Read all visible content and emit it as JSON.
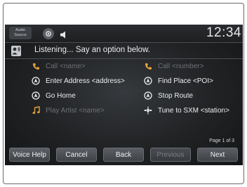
{
  "status_bar": {
    "audio_source_label": "Audio Source",
    "phone_icon": "phone-status-icon",
    "speaker_icon": "speaker-icon",
    "clock": "12:34"
  },
  "prompt": {
    "icon": "voice-command-icon",
    "text": "Listening... Say an option below."
  },
  "options": {
    "call_name": {
      "label": "Call <name>",
      "enabled": false,
      "icon": "phone-icon"
    },
    "call_number": {
      "label": "Call <number>",
      "enabled": false,
      "icon": "phone-icon"
    },
    "enter_address": {
      "label": "Enter Address <address>",
      "enabled": true,
      "icon": "navigation-icon"
    },
    "find_place": {
      "label": "Find Place <POI>",
      "enabled": true,
      "icon": "navigation-icon"
    },
    "go_home": {
      "label": "Go Home",
      "enabled": true,
      "icon": "navigation-icon"
    },
    "stop_route": {
      "label": "Stop Route",
      "enabled": true,
      "icon": "navigation-icon"
    },
    "play_artist": {
      "label": "Play Artist <name>",
      "enabled": false,
      "icon": "music-note-icon"
    },
    "tune_sxm": {
      "label": "Tune to SXM <station>",
      "enabled": true,
      "icon": "satellite-radio-icon"
    }
  },
  "pagination": {
    "label": "Page 1 of 3"
  },
  "buttons": {
    "voice_help": {
      "label": "Voice Help",
      "enabled": true
    },
    "cancel": {
      "label": "Cancel",
      "enabled": true
    },
    "back": {
      "label": "Back",
      "enabled": true
    },
    "previous": {
      "label": "Previous",
      "enabled": false
    },
    "next": {
      "label": "Next",
      "enabled": true
    }
  },
  "colors": {
    "screen_bg": "#202224",
    "text_enabled": "#eceef0",
    "text_disabled": "#6d7075",
    "button_bg": "#4e5257"
  }
}
